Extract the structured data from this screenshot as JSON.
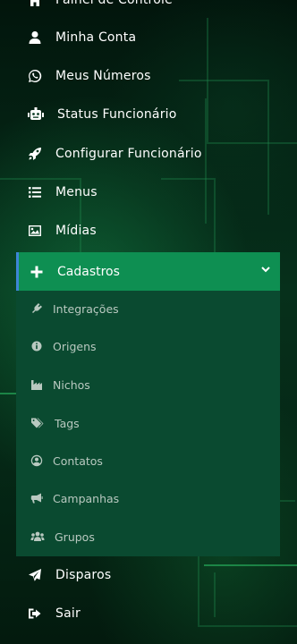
{
  "menu": {
    "top_partial": "Painel de Controle",
    "items": [
      {
        "label": "Minha Conta",
        "icon": "user-icon"
      },
      {
        "label": "Meus Números",
        "icon": "whatsapp-icon"
      },
      {
        "label": "Status Funcionário",
        "icon": "robot-icon"
      },
      {
        "label": "Configurar Funcionário",
        "icon": "rocket-icon"
      },
      {
        "label": "Menus",
        "icon": "list-icon"
      },
      {
        "label": "Mídias",
        "icon": "image-icon"
      }
    ],
    "active": {
      "label": "Cadastros",
      "icon": "plus-icon"
    },
    "submenu": [
      {
        "label": "Integrações",
        "icon": "plug-icon"
      },
      {
        "label": "Origens",
        "icon": "info-icon"
      },
      {
        "label": "Nichos",
        "icon": "industry-icon"
      },
      {
        "label": "Tags",
        "icon": "tags-icon"
      },
      {
        "label": "Contatos",
        "icon": "user-circle-icon"
      },
      {
        "label": "Campanhas",
        "icon": "bullhorn-icon"
      },
      {
        "label": "Grupos",
        "icon": "users-icon"
      }
    ],
    "bottom": [
      {
        "label": "Disparos",
        "icon": "paper-plane-icon"
      },
      {
        "label": "Sair",
        "icon": "sign-out-icon"
      }
    ]
  },
  "colors": {
    "background": "#041a10",
    "active_bg": "#0e8f52",
    "active_border": "#3d86d6",
    "submenu_bg": "#0a4a30",
    "submenu_text": "#b9c9c0"
  }
}
